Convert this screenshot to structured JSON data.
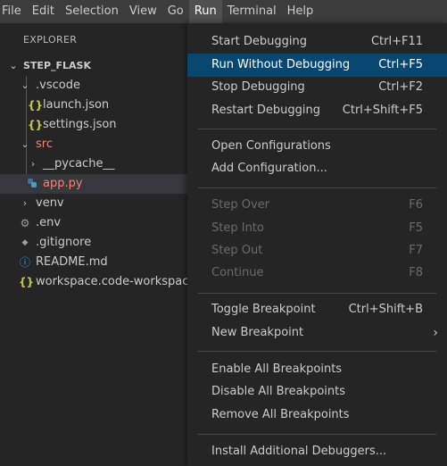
{
  "menubar": {
    "items": [
      "File",
      "Edit",
      "Selection",
      "View",
      "Go",
      "Run",
      "Terminal",
      "Help"
    ],
    "active": "Run"
  },
  "explorer": {
    "title": "EXPLORER",
    "root": "STEP_FLASK",
    "items": {
      "vscode": ".vscode",
      "launch": "launch.json",
      "settings": "settings.json",
      "src": "src",
      "pycache": "__pycache__",
      "app": "app.py",
      "venv": "venv",
      "env": ".env",
      "gitignore": ".gitignore",
      "readme": "README.md",
      "workspace": "workspace.code-workspace"
    },
    "icons": {
      "json": "{}",
      "gear": "⚙",
      "git": "◆",
      "info": "ⓘ",
      "python": "python-icon"
    }
  },
  "run_menu": {
    "start": {
      "label": "Start Debugging",
      "key": "Ctrl+F11"
    },
    "run_without": {
      "label": "Run Without Debugging",
      "key": "Ctrl+F5"
    },
    "stop": {
      "label": "Stop Debugging",
      "key": "Ctrl+F2"
    },
    "restart": {
      "label": "Restart Debugging",
      "key": "Ctrl+Shift+F5"
    },
    "open_config": {
      "label": "Open Configurations"
    },
    "add_config": {
      "label": "Add Configuration..."
    },
    "step_over": {
      "label": "Step Over",
      "key": "F6"
    },
    "step_into": {
      "label": "Step Into",
      "key": "F5"
    },
    "step_out": {
      "label": "Step Out",
      "key": "F7"
    },
    "continue": {
      "label": "Continue",
      "key": "F8"
    },
    "toggle_bp": {
      "label": "Toggle Breakpoint",
      "key": "Ctrl+Shift+B"
    },
    "new_bp": {
      "label": "New Breakpoint"
    },
    "enable_all": {
      "label": "Enable All Breakpoints"
    },
    "disable_all": {
      "label": "Disable All Breakpoints"
    },
    "remove_all": {
      "label": "Remove All Breakpoints"
    },
    "install": {
      "label": "Install Additional Debuggers..."
    }
  },
  "colors": {
    "highlight": "#094771",
    "selected_row": "#37373d",
    "error_text": "#f48771",
    "json_icon": "#cbcb41",
    "info_icon": "#40a6ff"
  }
}
